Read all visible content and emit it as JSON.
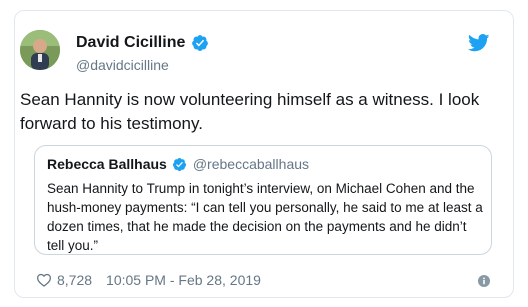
{
  "tweet": {
    "author_name": "David Cicilline",
    "author_handle": "@davidcicilline",
    "text": "Sean Hannity is now volunteering himself as a witness. I look forward to his testimony.",
    "likes": "8,728",
    "timestamp": "10:05 PM - Feb 28, 2019"
  },
  "quoted": {
    "author_name": "Rebecca Ballhaus",
    "author_handle": "@rebeccaballhaus",
    "text": "Sean Hannity to Trump in tonight’s interview, on Michael Cohen and the hush-money payments: “I can tell you personally, he said to me at least a dozen times, that he made the decision on the payments and he didn’t tell you.”"
  },
  "icons": {
    "verified": "verified-badge-icon",
    "twitter": "twitter-bird-icon",
    "like": "heart-icon",
    "info": "info-icon"
  },
  "colors": {
    "brand_blue": "#1da1f2",
    "text": "#14171a",
    "secondary": "#657786",
    "border": "#e1e8ed"
  }
}
